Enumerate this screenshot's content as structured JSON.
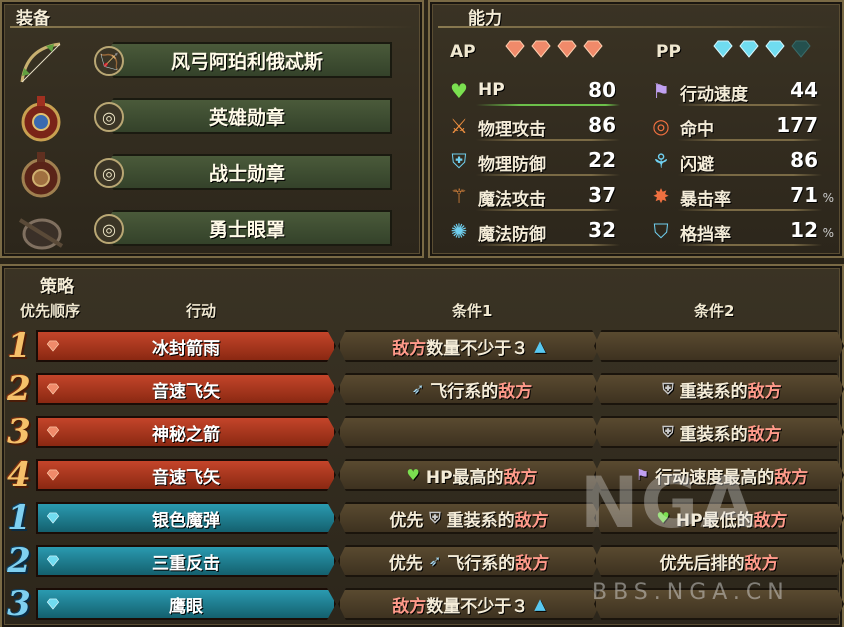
{
  "equipment": {
    "title": "装备",
    "items": [
      {
        "name": "风弓阿珀利俄忒斯",
        "icon": "bow-icon",
        "slot_icon": "bow-slot-icon"
      },
      {
        "name": "英雄勋章",
        "icon": "medal-icon",
        "slot_icon": "ring-slot-icon"
      },
      {
        "name": "战士勋章",
        "icon": "medal-icon",
        "slot_icon": "ring-slot-icon"
      },
      {
        "name": "勇士眼罩",
        "icon": "eyepatch-icon",
        "slot_icon": "ring-slot-icon"
      }
    ]
  },
  "abilities": {
    "title": "能力",
    "ap_label": "AP",
    "pp_label": "PP",
    "ap_gems": 4,
    "pp_gems_filled": 3,
    "pp_gems_total": 4,
    "left": [
      {
        "icon": "heart-icon",
        "label": "HP",
        "value": "80"
      },
      {
        "icon": "sword-icon",
        "label": "物理攻击",
        "value": "86"
      },
      {
        "icon": "armor-icon",
        "label": "物理防御",
        "value": "22"
      },
      {
        "icon": "staff-icon",
        "label": "魔法攻击",
        "value": "37"
      },
      {
        "icon": "magic-shield-icon",
        "label": "魔法防御",
        "value": "32"
      }
    ],
    "right": [
      {
        "icon": "wing-flag-icon",
        "label": "行动速度",
        "value": "44",
        "pct": ""
      },
      {
        "icon": "target-icon",
        "label": "命中",
        "value": "177",
        "pct": ""
      },
      {
        "icon": "dodge-icon",
        "label": "闪避",
        "value": "86",
        "pct": ""
      },
      {
        "icon": "critical-icon",
        "label": "暴击率",
        "value": "71",
        "pct": "%"
      },
      {
        "icon": "block-icon",
        "label": "格挡率",
        "value": "12",
        "pct": "%"
      }
    ]
  },
  "strategy": {
    "title": "策略",
    "headers": {
      "priority": "优先顺序",
      "action": "行动",
      "cond1": "条件1",
      "cond2": "条件2"
    },
    "rows": [
      {
        "rank": "1",
        "type": "red",
        "action": "冰封箭雨",
        "c1": {
          "prefix": "",
          "icon": "",
          "enemy_first": true,
          "text1": "敌方",
          "text2": "数量不少于３",
          "arrow": "▲"
        },
        "c2": {
          "prefix": "",
          "icon": "",
          "enemy_first": false,
          "text1": "",
          "text2": "",
          "arrow": ""
        }
      },
      {
        "rank": "2",
        "type": "red",
        "action": "音速飞矢",
        "c1": {
          "prefix": "",
          "icon": "wing-icon",
          "enemy_first": false,
          "text1": "飞行系的",
          "text2": "敌方",
          "arrow": ""
        },
        "c2": {
          "prefix": "",
          "icon": "heavy-armor-icon",
          "enemy_first": false,
          "text1": "重装系的",
          "text2": "敌方",
          "arrow": ""
        }
      },
      {
        "rank": "3",
        "type": "red",
        "action": "神秘之箭",
        "c1": {
          "prefix": "",
          "icon": "",
          "enemy_first": false,
          "text1": "",
          "text2": "",
          "arrow": ""
        },
        "c2": {
          "prefix": "",
          "icon": "heavy-armor-icon",
          "enemy_first": false,
          "text1": "重装系的",
          "text2": "敌方",
          "arrow": ""
        }
      },
      {
        "rank": "4",
        "type": "red",
        "action": "音速飞矢",
        "c1": {
          "prefix": "",
          "icon": "heart-icon",
          "enemy_first": false,
          "text1": "HP最高的",
          "text2": "敌方",
          "arrow": ""
        },
        "c2": {
          "prefix": "",
          "icon": "wing-flag-icon",
          "enemy_first": false,
          "text1": "行动速度最高的",
          "text2": "敌方",
          "arrow": ""
        }
      },
      {
        "rank": "1",
        "type": "blue",
        "action": "银色魔弹",
        "c1": {
          "prefix": "优先",
          "icon": "heavy-armor-icon",
          "enemy_first": false,
          "text1": "重装系的",
          "text2": "敌方",
          "arrow": ""
        },
        "c2": {
          "prefix": "",
          "icon": "heart-icon",
          "enemy_first": false,
          "text1": "HP最低的",
          "text2": "敌方",
          "arrow": ""
        }
      },
      {
        "rank": "2",
        "type": "blue",
        "action": "三重反击",
        "c1": {
          "prefix": "优先",
          "icon": "wing-icon",
          "enemy_first": false,
          "text1": "飞行系的",
          "text2": "敌方",
          "arrow": ""
        },
        "c2": {
          "prefix": "",
          "icon": "",
          "enemy_first": false,
          "text1": "优先后排的",
          "text2": "敌方",
          "arrow": ""
        }
      },
      {
        "rank": "3",
        "type": "blue",
        "action": "鹰眼",
        "c1": {
          "prefix": "",
          "icon": "",
          "enemy_first": true,
          "text1": "敌方",
          "text2": "数量不少于３",
          "arrow": "▲"
        },
        "c2": {
          "prefix": "",
          "icon": "",
          "enemy_first": false,
          "text1": "",
          "text2": "",
          "arrow": ""
        }
      }
    ]
  },
  "watermark": {
    "logo": "NGA",
    "url": "BBS.NGA.CN"
  },
  "colors": {
    "enemy": "#ff9a8a",
    "red_action": "#b23a20",
    "blue_action": "#2088a0",
    "rank_orange": "#f5c06a",
    "rank_blue": "#7fd0f0"
  }
}
